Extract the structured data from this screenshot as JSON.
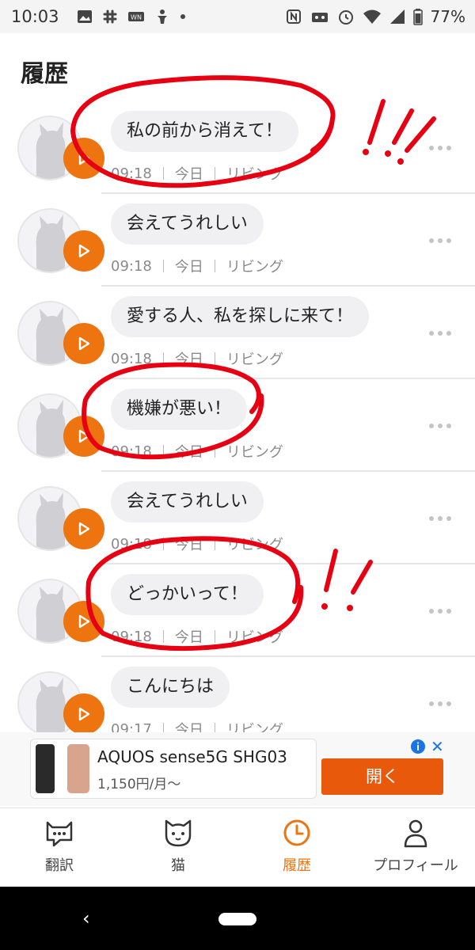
{
  "status_bar": {
    "time": "10:03",
    "battery": "77%",
    "icons_left": [
      "image-icon",
      "slack-icon",
      "app-icon",
      "figure-icon",
      "dot-icon"
    ],
    "icons_right": [
      "nfc-icon",
      "robot-icon",
      "alarm-icon",
      "wifi-icon",
      "signal-icon",
      "battery-icon"
    ]
  },
  "header": {
    "title": "履歴"
  },
  "history": [
    {
      "message": "私の前から消えて！",
      "time": "09:18",
      "day": "今日",
      "room": "リビング"
    },
    {
      "message": "会えてうれしい",
      "time": "09:18",
      "day": "今日",
      "room": "リビング"
    },
    {
      "message": "愛する人、私を探しに来て！",
      "time": "09:18",
      "day": "今日",
      "room": "リビング"
    },
    {
      "message": "機嫌が悪い！",
      "time": "09:18",
      "day": "今日",
      "room": "リビング"
    },
    {
      "message": "会えてうれしい",
      "time": "09:18",
      "day": "今日",
      "room": "リビング"
    },
    {
      "message": "どっかいって！",
      "time": "09:18",
      "day": "今日",
      "room": "リビング"
    },
    {
      "message": "こんにちは",
      "time": "09:17",
      "day": "今日",
      "room": "リビング"
    }
  ],
  "ad": {
    "title": "AQUOS sense5G SHG03",
    "price": "1,150円/月〜",
    "open_label": "開く"
  },
  "tabs": [
    {
      "label": "翻訳",
      "icon": "chat-cat-icon"
    },
    {
      "label": "猫",
      "icon": "cat-face-icon"
    },
    {
      "label": "履歴",
      "icon": "clock-icon"
    },
    {
      "label": "プロフィール",
      "icon": "person-icon"
    }
  ],
  "colors": {
    "accent": "#ee7410",
    "annotation": "#e60012",
    "ad_button": "#e8590c"
  }
}
